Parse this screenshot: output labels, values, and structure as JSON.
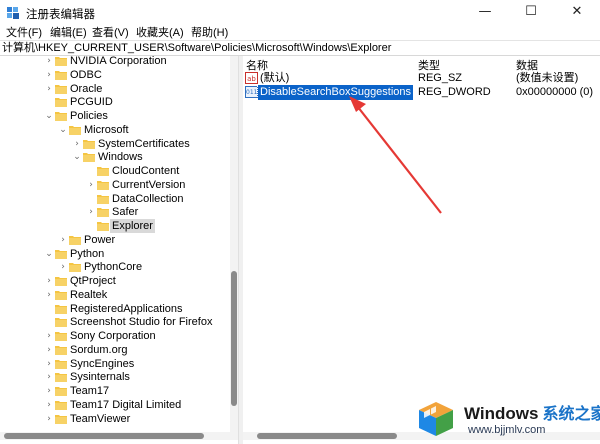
{
  "window": {
    "title": "注册表编辑器",
    "minimize_glyph": "—",
    "maximize_glyph": "☐",
    "close_glyph": "✕"
  },
  "menu": [
    "文件(F)",
    "编辑(E)",
    "查看(V)",
    "收藏夹(A)",
    "帮助(H)"
  ],
  "address": "计算机\\HKEY_CURRENT_USER\\Software\\Policies\\Microsoft\\Windows\\Explorer",
  "tree": [
    {
      "label": "NVIDIA Corporation",
      "expander": "collapsed"
    },
    {
      "label": "ODBC",
      "expander": "collapsed"
    },
    {
      "label": "Oracle",
      "expander": "collapsed"
    },
    {
      "label": "PCGUID",
      "expander": "none"
    },
    {
      "label": "Policies",
      "expander": "expanded"
    },
    {
      "label": "Microsoft",
      "expander": "expanded"
    },
    {
      "label": "SystemCertificates",
      "expander": "collapsed"
    },
    {
      "label": "Windows",
      "expander": "expanded"
    },
    {
      "label": "CloudContent",
      "expander": "none"
    },
    {
      "label": "CurrentVersion",
      "expander": "collapsed"
    },
    {
      "label": "DataCollection",
      "expander": "none"
    },
    {
      "label": "Safer",
      "expander": "collapsed"
    },
    {
      "label": "Explorer",
      "expander": "none",
      "selected": true
    },
    {
      "label": "Power",
      "expander": "collapsed"
    },
    {
      "label": "Python",
      "expander": "expanded"
    },
    {
      "label": "PythonCore",
      "expander": "collapsed"
    },
    {
      "label": "QtProject",
      "expander": "collapsed"
    },
    {
      "label": "Realtek",
      "expander": "collapsed"
    },
    {
      "label": "RegisteredApplications",
      "expander": "none"
    },
    {
      "label": "Screenshot Studio for Firefox",
      "expander": "none"
    },
    {
      "label": "Sony Corporation",
      "expander": "collapsed"
    },
    {
      "label": "Sordum.org",
      "expander": "collapsed"
    },
    {
      "label": "SyncEngines",
      "expander": "collapsed"
    },
    {
      "label": "Sysinternals",
      "expander": "collapsed"
    },
    {
      "label": "Team17",
      "expander": "collapsed"
    },
    {
      "label": "Team17 Digital Limited",
      "expander": "collapsed"
    },
    {
      "label": "TeamViewer",
      "expander": "collapsed"
    }
  ],
  "columns": {
    "name": "名称",
    "type": "类型",
    "data": "数据"
  },
  "values": [
    {
      "icon": "string-value-icon",
      "icon_glyph": "ab",
      "name": "(默认)",
      "type": "REG_SZ",
      "data": "(数值未设置)"
    },
    {
      "icon": "dword-value-icon",
      "icon_glyph": "011",
      "name": "DisableSearchBoxSuggestions",
      "type": "REG_DWORD",
      "data": "0x00000000 (0)",
      "selected": true
    }
  ],
  "watermark": {
    "brand": "Windows",
    "sub": "系统之家",
    "url": "www.bjjmlv.com"
  },
  "colors": {
    "selection": "#0b63c9",
    "folder": "#f5c542",
    "arrow": "#e53935",
    "tree_selected": "#d9d9d9"
  }
}
